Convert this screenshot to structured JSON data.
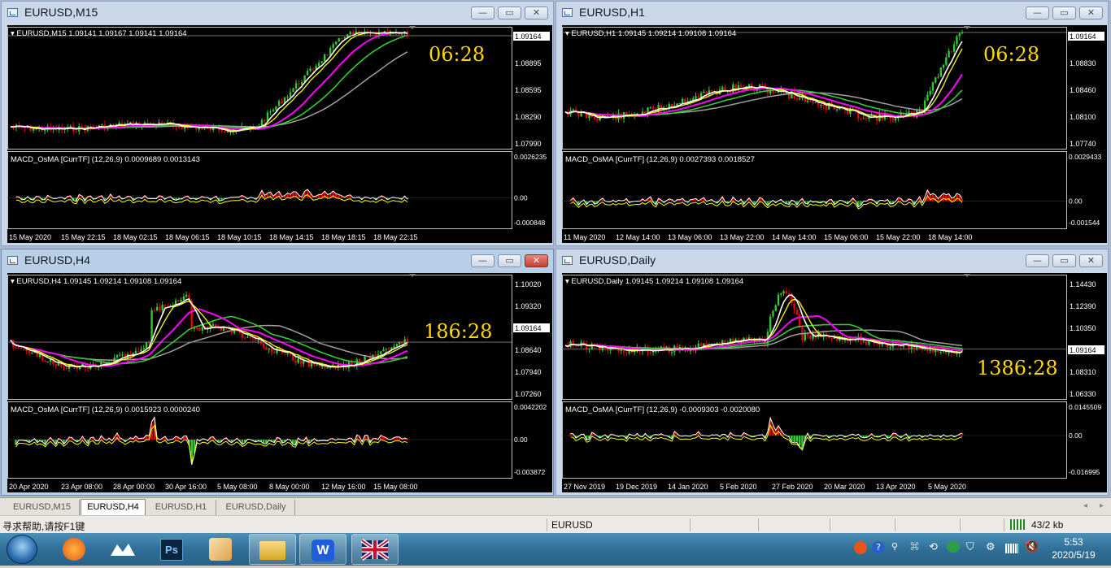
{
  "windows": [
    {
      "id": "m15",
      "title": "EURUSD,M15",
      "active": false,
      "close_red": false,
      "header": "EURUSD,M15  1.09141 1.09167 1.09141 1.09164",
      "timer": "06:28",
      "price_labels": [
        "1.09164",
        "1.08895",
        "1.08595",
        "1.08290",
        "1.07990"
      ],
      "current_price": "1.09164",
      "macd_header": "MACD_OsMA [CurrTF] (12,26,9) 0.0009689 0.0013143",
      "macd_labels": [
        "0.0026235",
        "0.00",
        "-0.000848"
      ],
      "time_labels": [
        "15 May 2020",
        "15 May 22:15",
        "18 May 02:15",
        "18 May 06:15",
        "18 May 10:15",
        "18 May 14:15",
        "18 May 18:15",
        "18 May 22:15"
      ]
    },
    {
      "id": "h1",
      "title": "EURUSD,H1",
      "active": false,
      "close_red": false,
      "header": "EURUSD,H1  1.09145 1.09214 1.09108 1.09164",
      "timer": "06:28",
      "price_labels": [
        "1.09164",
        "1.08830",
        "1.08460",
        "1.08100",
        "1.07740"
      ],
      "current_price": "1.09164",
      "macd_header": "MACD_OsMA [CurrTF] (12,26,9) 0.0027393 0.0018527",
      "macd_labels": [
        "0.0029433",
        "0.00",
        "-0.001544"
      ],
      "time_labels": [
        "11 May 2020",
        "12 May 14:00",
        "13 May 06:00",
        "13 May 22:00",
        "14 May 14:00",
        "15 May 06:00",
        "15 May 22:00",
        "18 May 14:00"
      ]
    },
    {
      "id": "h4",
      "title": "EURUSD,H4",
      "active": true,
      "close_red": true,
      "header": "EURUSD,H4  1.09145 1.09214 1.09108 1.09164",
      "timer": "186:28",
      "price_labels": [
        "1.10020",
        "1.09320",
        "1.09164",
        "1.08640",
        "1.07940",
        "1.07260"
      ],
      "current_price": "1.09164",
      "macd_header": "MACD_OsMA [CurrTF] (12,26,9) 0.0015923 0.0000240",
      "macd_labels": [
        "0.0042202",
        "0.00",
        "-0.003872"
      ],
      "time_labels": [
        "20 Apr 2020",
        "23 Apr 08:00",
        "28 Apr 00:00",
        "30 Apr 16:00",
        "5 May 08:00",
        "8 May 00:00",
        "12 May 16:00",
        "15 May 08:00"
      ]
    },
    {
      "id": "daily",
      "title": "EURUSD,Daily",
      "active": false,
      "close_red": false,
      "header": "EURUSD,Daily  1.09145 1.09214 1.09108 1.09164",
      "timer": "1386:28",
      "price_labels": [
        "1.14430",
        "1.12390",
        "1.10350",
        "1.09164",
        "1.08310",
        "1.06330"
      ],
      "current_price": "1.09164",
      "macd_header": "MACD_OsMA [CurrTF] (12,26,9) -0.0009303 -0.0020080",
      "macd_labels": [
        "0.0145509",
        "0.00",
        "-0.016995"
      ],
      "time_labels": [
        "27 Nov 2019",
        "19 Dec 2019",
        "14 Jan 2020",
        "5 Feb 2020",
        "27 Feb 2020",
        "20 Mar 2020",
        "13 Apr 2020",
        "5 May 2020"
      ]
    }
  ],
  "window_buttons": {
    "minimize": "—",
    "maximize": "▭",
    "close": "✕"
  },
  "tabs": [
    "EURUSD,M15",
    "EURUSD,H4",
    "EURUSD,H1",
    "EURUSD,Daily"
  ],
  "selected_tab": "EURUSD,H4",
  "status": {
    "help": "寻求帮助,请按F1键",
    "symbol": "EURUSD",
    "traffic": "43/2 kb"
  },
  "taskbar": {
    "apps": [
      "start-orb",
      "media-player",
      "baidu-netdisk",
      "photoshop",
      "paint",
      "file-explorer",
      "wps-writer",
      "uk-flag"
    ]
  },
  "clock": {
    "time": "5:53",
    "date": "2020/5/19"
  },
  "colors": {
    "up": "#32c832",
    "down": "#e60000",
    "ma_white": "#ffffff",
    "ma_yellow": "#ffff00",
    "ma_magenta": "#ff00ff",
    "ma_green": "#32cd32",
    "ma_gray": "#a0a0a0",
    "timer": "#ffd700"
  }
}
